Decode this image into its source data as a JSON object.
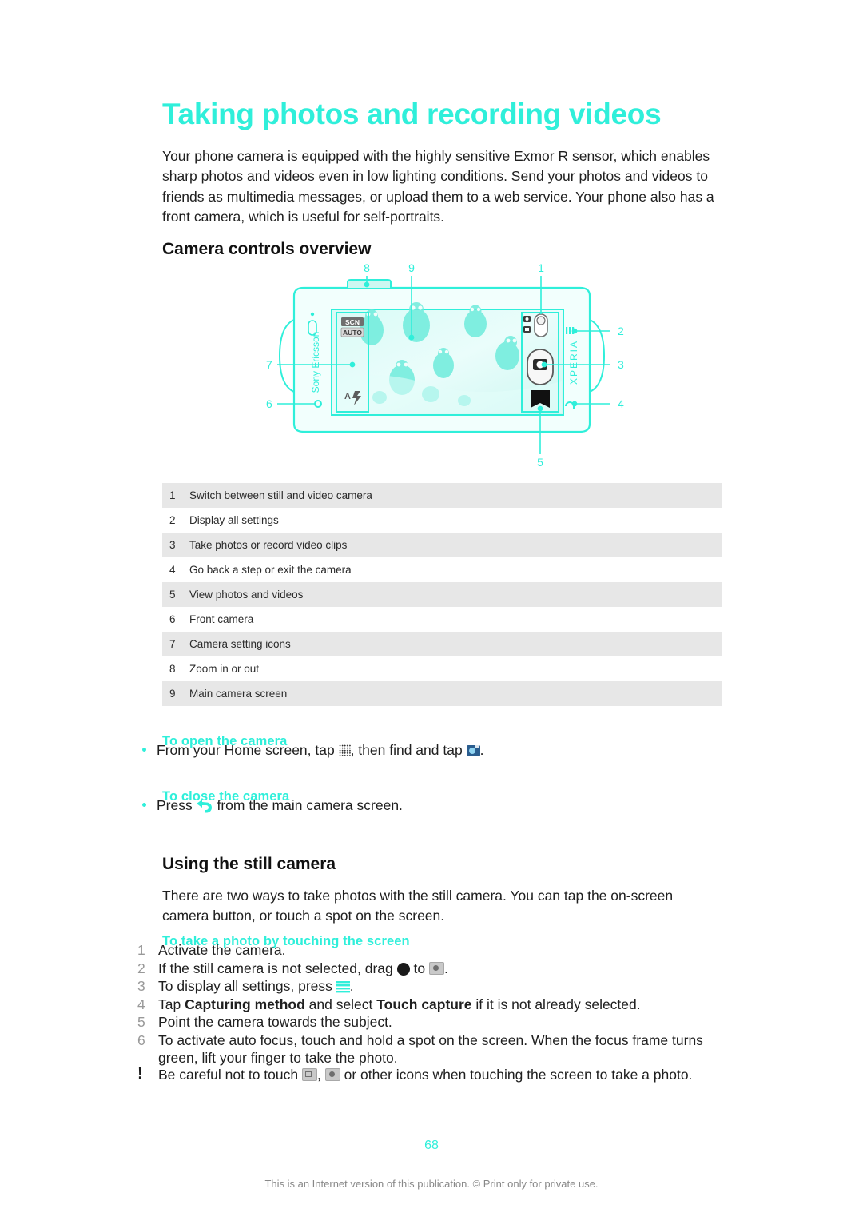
{
  "document": {
    "title": "Taking photos and recording videos",
    "intro": "Your phone camera is equipped with the highly sensitive Exmor R sensor, which enables sharp photos and videos even in low lighting conditions. Send your photos and videos to friends as multimedia messages, or upload them to a web service. Your phone also has a front camera, which is useful for self-portraits.",
    "page_number": "68",
    "footer": "This is an Internet version of this publication. © Print only for private use."
  },
  "colors": {
    "accent": "#2FEFDA",
    "body_text": "#1f1f1f",
    "row_shade": "#e7e7e7",
    "step_number": "#999999",
    "footer_text": "#888888"
  },
  "camera_overview": {
    "heading": "Camera controls overview",
    "diagram": {
      "brand_left": "Sony Ericsson",
      "brand_right": "XPERIA",
      "setting_badges": [
        "SCN",
        "AUTO"
      ],
      "callout_numbers": [
        "1",
        "2",
        "3",
        "4",
        "5",
        "6",
        "7",
        "8",
        "9"
      ]
    },
    "legend": [
      {
        "num": "1",
        "text": "Switch between still and video camera"
      },
      {
        "num": "2",
        "text": "Display all settings"
      },
      {
        "num": "3",
        "text": "Take photos or record video clips"
      },
      {
        "num": "4",
        "text": "Go back a step or exit the camera"
      },
      {
        "num": "5",
        "text": "View photos and videos"
      },
      {
        "num": "6",
        "text": "Front camera"
      },
      {
        "num": "7",
        "text": "Camera setting icons"
      },
      {
        "num": "8",
        "text": "Zoom in or out"
      },
      {
        "num": "9",
        "text": "Main camera screen"
      }
    ]
  },
  "open_camera": {
    "heading": "To open the camera",
    "text_before_grid": "From your Home screen, tap ",
    "text_between": ", then find and tap ",
    "text_after": "."
  },
  "close_camera": {
    "heading": "To close the camera",
    "text_before": "Press ",
    "text_after": " from the main camera screen."
  },
  "still_camera": {
    "heading": "Using the still camera",
    "paragraph": "There are two ways to take photos with the still camera. You can tap the on-screen camera button, or touch a spot on the screen.",
    "touch_heading": "To take a photo by touching the screen",
    "steps": [
      {
        "num": "1",
        "text": "Activate the camera."
      },
      {
        "num": "2",
        "pre": "If the still camera is not selected, drag ",
        "mid": " to ",
        "post": "."
      },
      {
        "num": "3",
        "pre": "To display all settings, press ",
        "post": "."
      },
      {
        "num": "4",
        "pre": "Tap ",
        "bold1": "Capturing method",
        "mid": " and select ",
        "bold2": "Touch capture",
        "post": " if it is not already selected."
      },
      {
        "num": "5",
        "text": "Point the camera towards the subject."
      },
      {
        "num": "6",
        "text": "To activate auto focus, touch and hold a spot on the screen. When the focus frame turns green, lift your finger to take the photo."
      }
    ],
    "note": {
      "mark": "!",
      "pre": "Be careful not to touch ",
      "mid": ", ",
      "post": " or other icons when touching the screen to take a photo."
    }
  }
}
